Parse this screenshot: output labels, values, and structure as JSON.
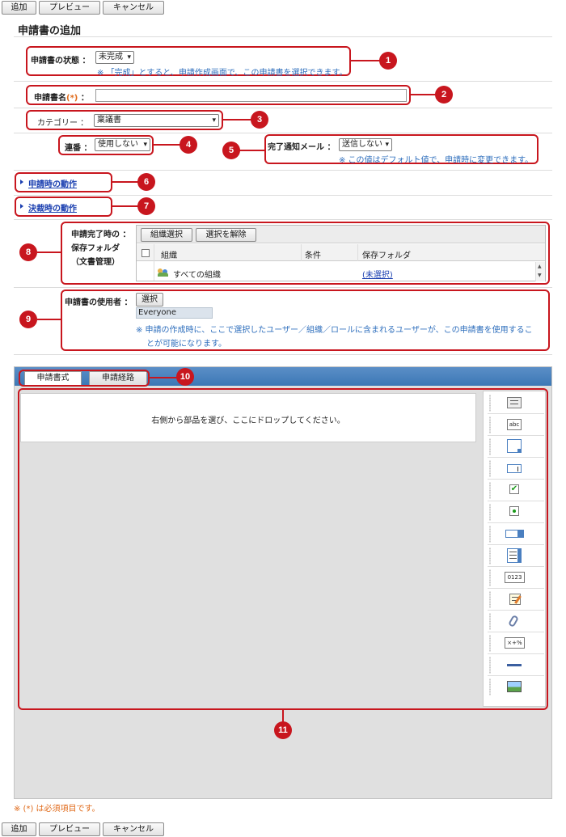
{
  "toolbar": {
    "add": "追加",
    "preview": "プレビュー",
    "cancel": "キャンセル"
  },
  "page_title": "申請書の追加",
  "status": {
    "label": "申請書の状態 ：",
    "value": "未完成",
    "note": "※ 「完成」とすると、申請作成画面で、この申請書を選択できます。"
  },
  "name": {
    "label": "申請書名",
    "required_mark": "(*)",
    "colon": "：",
    "value": ""
  },
  "category": {
    "label": "カテゴリー ：",
    "value": "稟議書"
  },
  "serial": {
    "label": "連番 ：",
    "value": "使用しない"
  },
  "mail": {
    "label": "完了通知メール ：",
    "value": "送信しない",
    "note": "※ この値はデフォルト値で、申請時に変更できます。"
  },
  "section_apply": "申請時の動作",
  "section_decide": "決裁時の動作",
  "folder": {
    "label_line1": "申請完了時の ：",
    "label_line2": "保存フォルダ",
    "label_line3": "（文書管理）",
    "select_button": "組織選択",
    "clear_button": "選択を解除",
    "columns": [
      "組織",
      "条件",
      "保存フォルダ"
    ],
    "rows": [
      {
        "org": "すべての組織",
        "condition": "",
        "folder": "(未選択)"
      }
    ]
  },
  "users": {
    "label": "申請書の使用者 ：",
    "select_button": "選択",
    "value": "Everyone",
    "note_line1": "※ 申請の作成時に、ここで選択したユーザー／組織／ロールに含まれるユーザーが、この申請書を使用するこ",
    "note_line2": "とが可能になります。"
  },
  "tabs": [
    "申請書式",
    "申請経路"
  ],
  "drop_hint": "右側から部品を選び、ここにドロップしてください。",
  "palette": [
    {
      "icon": "label-part-icon"
    },
    {
      "icon": "text-part-icon",
      "text": "abc"
    },
    {
      "icon": "textarea-part-icon"
    },
    {
      "icon": "textfield-part-icon"
    },
    {
      "icon": "checkbox-part-icon"
    },
    {
      "icon": "radio-part-icon"
    },
    {
      "icon": "dropdown-part-icon"
    },
    {
      "icon": "listbox-part-icon"
    },
    {
      "icon": "number-part-icon",
      "text": "0123"
    },
    {
      "icon": "richtext-part-icon"
    },
    {
      "icon": "attachment-part-icon"
    },
    {
      "icon": "calc-part-icon",
      "text": "×+%"
    },
    {
      "icon": "separator-part-icon"
    },
    {
      "icon": "image-part-icon"
    }
  ],
  "footer_note": "※ (*) は必須項目です。",
  "badges": [
    "1",
    "2",
    "3",
    "4",
    "5",
    "6",
    "7",
    "8",
    "9",
    "10",
    "11"
  ],
  "colors": {
    "accent_red": "#c8161e",
    "link_blue": "#1a3fb0",
    "note_blue": "#2f6fbd",
    "header_blue": "#3c78b5"
  }
}
